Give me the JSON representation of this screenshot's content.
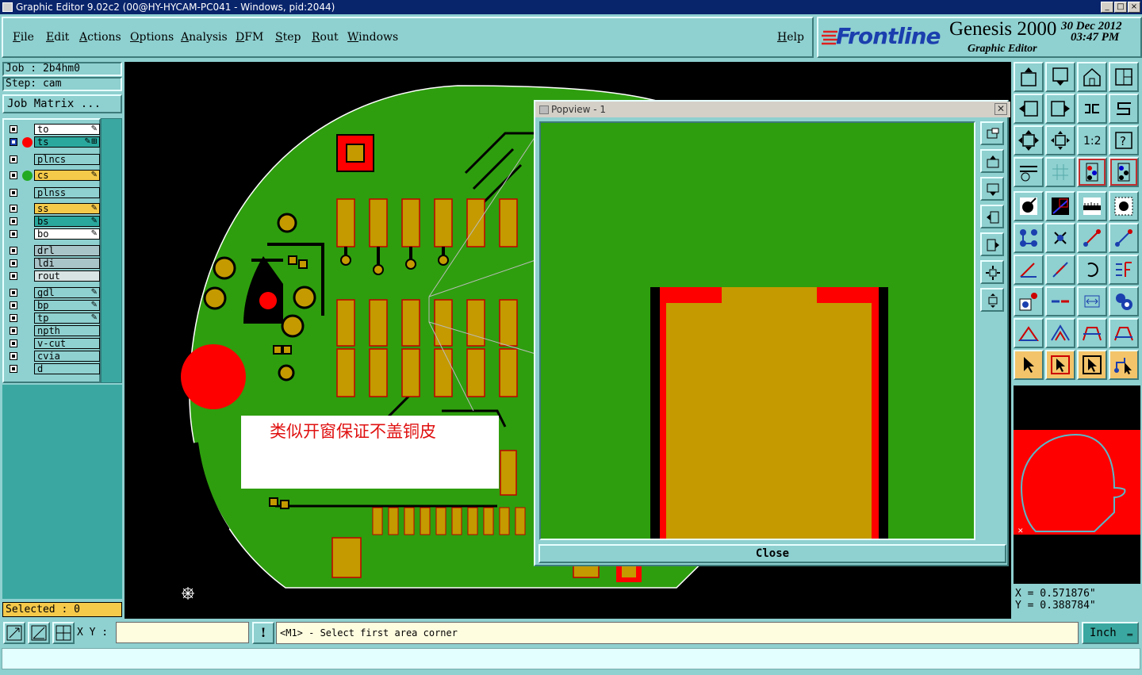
{
  "window": {
    "title": "Graphic Editor 9.02c2 (00@HY-HYCAM-PC041 - Windows, pid:2044)",
    "controls": [
      "_",
      "□",
      "×"
    ]
  },
  "menu": [
    {
      "label": "File"
    },
    {
      "label": "Edit"
    },
    {
      "label": "Actions"
    },
    {
      "label": "Options"
    },
    {
      "label": "Analysis"
    },
    {
      "label": "DFM"
    },
    {
      "label": "Step"
    },
    {
      "label": "Rout"
    },
    {
      "label": "Windows"
    },
    {
      "label": "Help"
    }
  ],
  "brand": {
    "logo": "Frontline",
    "product": "Genesis 2000",
    "module": "Graphic Editor",
    "date": "30 Dec 2012",
    "time": "03:47 PM"
  },
  "job": {
    "job_label": "Job : 2b4hm0",
    "step_label": "Step: cam",
    "matrix_button": "Job Matrix ..."
  },
  "layers": [
    {
      "name": "to",
      "bg": "#ffffff",
      "dot": null,
      "mark": "✎",
      "checked": false
    },
    {
      "name": "ts",
      "bg": "#2aa89e",
      "dot": "#ff0000",
      "mark": "✎⊞",
      "checked": true
    },
    {
      "name": "plncs",
      "bg": "#8fd0d0",
      "dot": null,
      "mark": "",
      "checked": false
    },
    {
      "name": "cs",
      "bg": "#f5c94a",
      "dot": "#22aa22",
      "mark": "✎",
      "checked": false
    },
    {
      "name": "plnss",
      "bg": "#8fd0d0",
      "dot": null,
      "mark": "",
      "checked": false
    },
    {
      "name": "ss",
      "bg": "#f5c94a",
      "dot": null,
      "mark": "✎",
      "checked": false
    },
    {
      "name": "bs",
      "bg": "#2aa89e",
      "dot": null,
      "mark": "✎",
      "checked": false
    },
    {
      "name": "bo",
      "bg": "#ffffff",
      "dot": null,
      "mark": "✎",
      "checked": false
    },
    {
      "name": "drl",
      "bg": "#a9c4c8",
      "dot": null,
      "mark": "",
      "checked": false
    },
    {
      "name": "ldi",
      "bg": "#a9c4c8",
      "dot": null,
      "mark": "",
      "checked": false
    },
    {
      "name": "rout",
      "bg": "#d8e4e4",
      "dot": null,
      "mark": "",
      "checked": false
    },
    {
      "name": "gdl",
      "bg": "#8fd0d0",
      "dot": null,
      "mark": "✎",
      "checked": false
    },
    {
      "name": "bp",
      "bg": "#8fd0d0",
      "dot": null,
      "mark": "✎",
      "checked": false
    },
    {
      "name": "tp",
      "bg": "#8fd0d0",
      "dot": null,
      "mark": "✎",
      "checked": false
    },
    {
      "name": "npth",
      "bg": "#8fd0d0",
      "dot": null,
      "mark": "",
      "checked": false
    },
    {
      "name": "v-cut",
      "bg": "#8fd0d0",
      "dot": null,
      "mark": "",
      "checked": false
    },
    {
      "name": "cvia",
      "bg": "#8fd0d0",
      "dot": null,
      "mark": "",
      "checked": false
    },
    {
      "name": "d",
      "bg": "#8fd0d0",
      "dot": null,
      "mark": "",
      "checked": false
    }
  ],
  "selected_label": "Selected : 0",
  "annotation": "类似开窗保证不盖铜皮",
  "popview": {
    "title": "Popview - 1",
    "close_label": "Close"
  },
  "coords": {
    "x": "X = 0.571876\"",
    "y": "Y = 0.388784\""
  },
  "bottom": {
    "xy_label": "X Y :",
    "xy_value": "",
    "message": "<M1> - Select first area corner",
    "warn_icon": "!",
    "units": "Inch"
  },
  "colors": {
    "panel": "#8fd0d0",
    "board_green": "#2e9e0e",
    "pad_gold": "#c49a00",
    "mask_red": "#ff0000",
    "highlight": "#f5c94a"
  }
}
